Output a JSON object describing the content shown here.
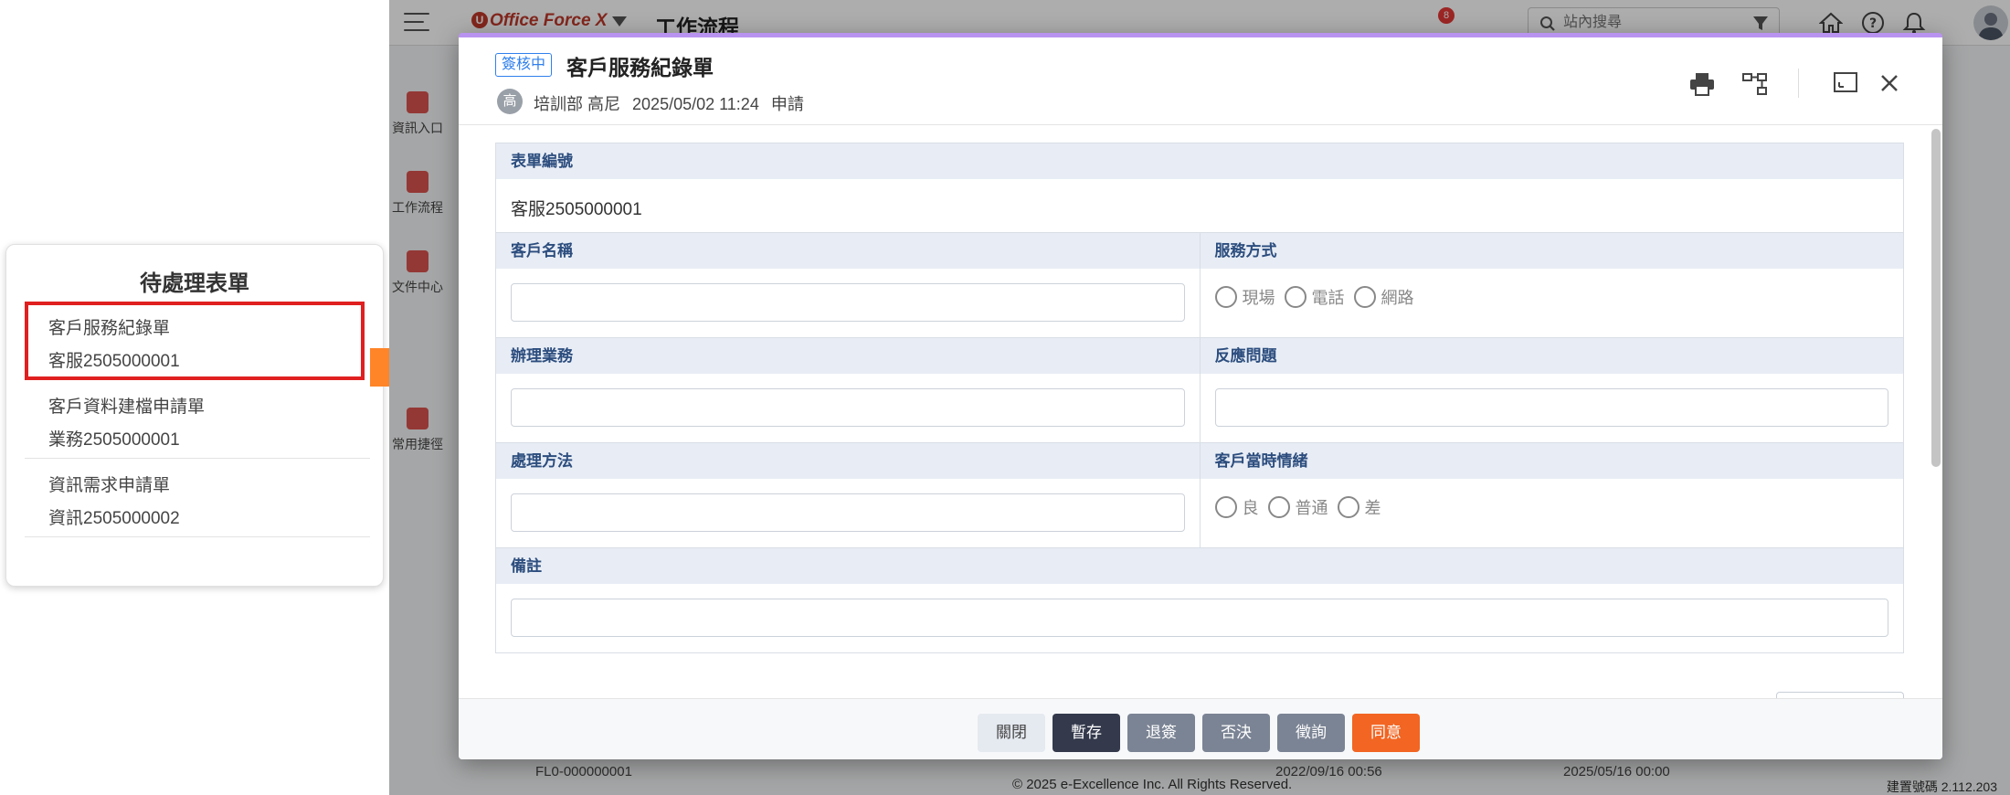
{
  "pending": {
    "title": "待處理表單",
    "items": [
      {
        "line1": "客戶服務紀錄單",
        "line2": "客服2505000001"
      },
      {
        "line1": "客戶資料建檔申請單",
        "line2": "業務2505000001"
      },
      {
        "line1": "資訊需求申請單",
        "line2": "資訊2505000002"
      }
    ]
  },
  "app": {
    "logo": "Office Force X",
    "title": "工作流程",
    "search_placeholder": "站內搜尋",
    "notification_count": "8",
    "nav": [
      {
        "label": "資訊入口"
      },
      {
        "label": "工作流程"
      },
      {
        "label": "文件中心"
      },
      {
        "label": "常用捷徑"
      }
    ],
    "footer_copyright": "© 2025 e-Excellence Inc. All Rights Reserved.",
    "footer_build": "建置號碼 2.112.203",
    "behind_text": {
      "left": "FL0-000000001",
      "mid": "2022/09/16 00:56",
      "right": "2025/05/16 00:00"
    }
  },
  "modal": {
    "status_tag": "簽核中",
    "title": "客戶服務紀錄單",
    "applicant_initial": "高",
    "applicant_dept": "培訓部 高尼",
    "applicant_time": "2025/05/02 11:24",
    "applicant_action": "申請",
    "form": {
      "form_no_label": "表單編號",
      "form_no_value": "客服2505000001",
      "customer_name_label": "客戶名稱",
      "service_method_label": "服務方式",
      "service_methods": [
        "現場",
        "電話",
        "網路"
      ],
      "business_label": "辦理業務",
      "feedback_label": "反應問題",
      "handling_label": "處理方法",
      "mood_label": "客戶當時情緒",
      "moods": [
        "良",
        "普通",
        "差"
      ],
      "remarks_label": "備註"
    },
    "buttons": {
      "close": "關閉",
      "save": "暫存",
      "return": "退簽",
      "reject": "否決",
      "consult": "徵詢",
      "agree": "同意"
    }
  }
}
